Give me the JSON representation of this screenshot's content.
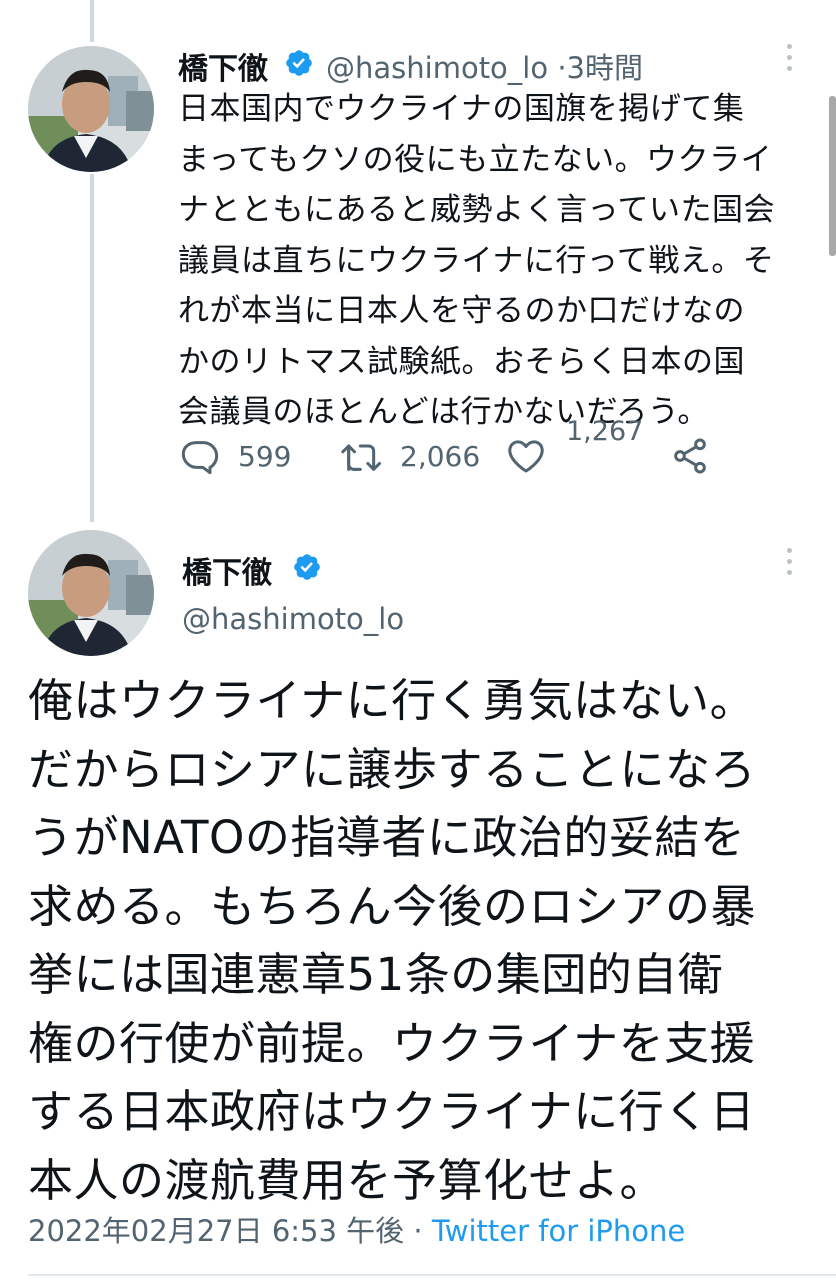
{
  "tweet1": {
    "display_name": "橋下徹",
    "handle": "@hashimoto_lo",
    "separator": "·",
    "time": "3時間",
    "body_lines": [
      "日本国内でウクライナの国旗を掲げて集",
      "まってもクソの役にも立たない。ウクライ",
      "ナとともにあると威勢よく言っていた国会",
      "議員は直ちにウクライナに行って戦え。そ",
      "れが本当に日本人を守るのか口だけなの",
      "かのリトマス試験紙。おそらく日本の国",
      "会議員のほとんどは行かないだろう。"
    ],
    "replies": "599",
    "retweets": "2,066",
    "likes": "1,267"
  },
  "tweet2": {
    "display_name": "橋下徹",
    "handle": "@hashimoto_lo",
    "body_lines": [
      "俺はウクライナに行く勇気はない。",
      "だからロシアに譲歩することになろ",
      "うがNATOの指導者に政治的妥結を",
      "求める。もちろん今後のロシアの暴",
      "挙には国連憲章51条の集団的自衛",
      "権の行使が前提。ウクライナを支援",
      "する日本政府はウクライナに行く日",
      "本人の渡航費用を予算化せよ。"
    ],
    "timestamp": "2022年02月27日 6:53 午後",
    "separator": "·",
    "source": "Twitter for iPhone"
  },
  "icons": {
    "verified": "verified-badge-icon",
    "more": "more-vertical-icon",
    "reply": "reply-icon",
    "retweet": "retweet-icon",
    "like": "like-icon",
    "share": "share-icon"
  },
  "colors": {
    "accent": "#1d9bf0",
    "text": "#0f1419",
    "secondary": "#536471",
    "thread_line": "#cfd9de"
  }
}
